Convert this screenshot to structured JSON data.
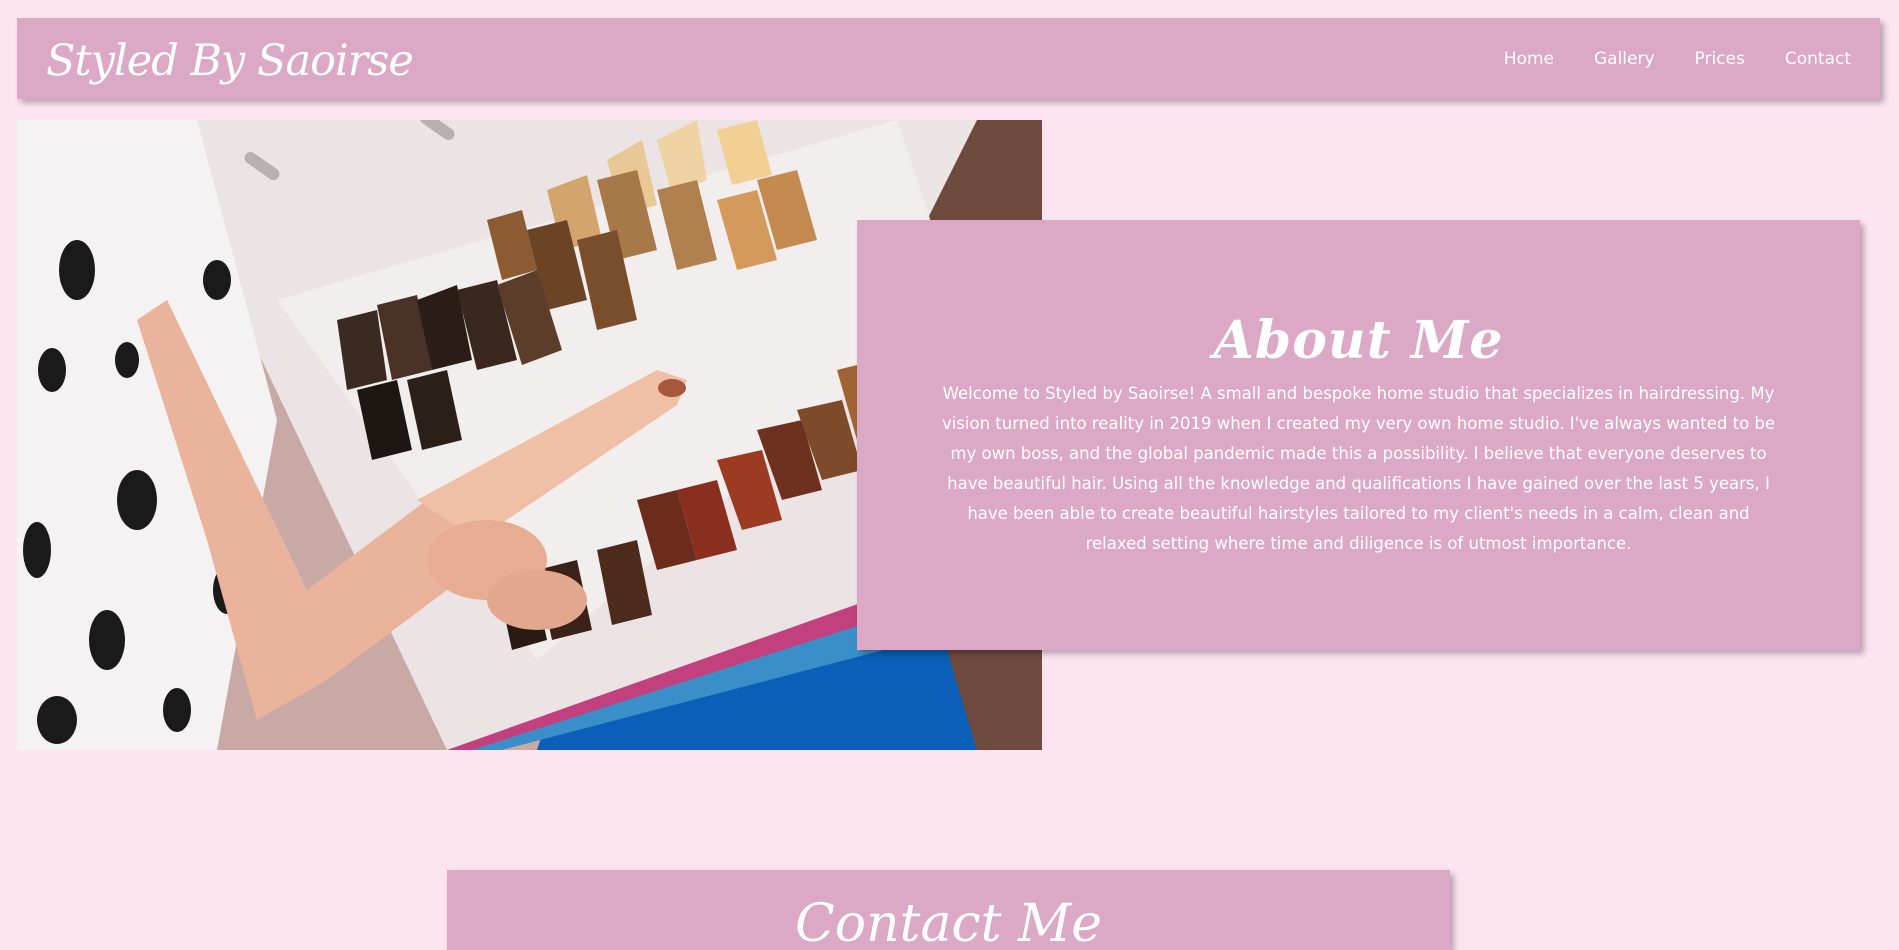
{
  "nav": {
    "brand": "Styled By Saoirse",
    "links": [
      "Home",
      "Gallery",
      "Prices",
      "Contact"
    ]
  },
  "hero": {
    "image_description_icon": "hair-color-swatch-book-photo"
  },
  "about": {
    "title": "About Me",
    "body": "Welcome to Styled by Saoirse! A small and bespoke home studio that specializes in hairdressing. My vision turned into reality in 2019 when I created my very own home studio. I've always wanted to be my own boss, and the global pandemic made this a possibility. I believe that everyone deserves to have beautiful hair. Using all the knowledge and qualifications I have gained over the last 5 years, I have been able to create beautiful hairstyles tailored to my client's needs in a calm, clean and relaxed setting where time and diligence is of utmost importance."
  },
  "second_section": {
    "title": "Contact Me"
  },
  "colors": {
    "page_background": "#fde4f1",
    "panel": "#dba8c6",
    "text": "#ffffff"
  }
}
